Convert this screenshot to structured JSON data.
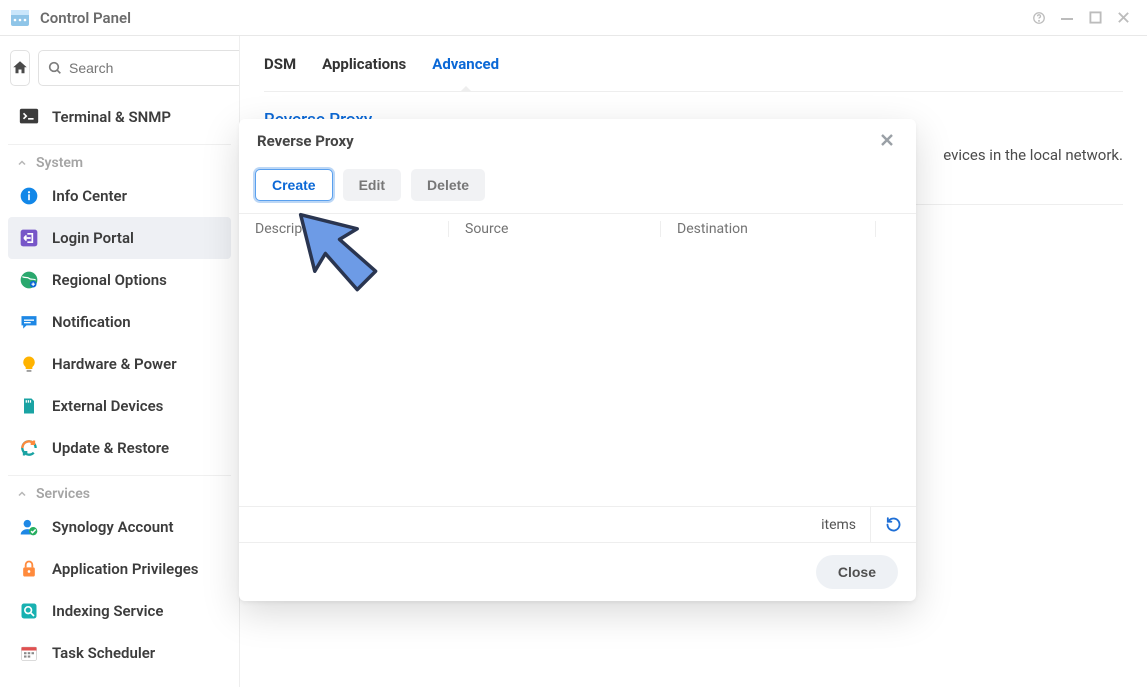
{
  "window": {
    "title": "Control Panel"
  },
  "sidebar": {
    "search_placeholder": "Search",
    "top_item": {
      "label": "Terminal & SNMP"
    },
    "sections": [
      {
        "label": "System",
        "items": [
          {
            "id": "info-center",
            "label": "Info Center"
          },
          {
            "id": "login-portal",
            "label": "Login Portal",
            "active": true
          },
          {
            "id": "regional-options",
            "label": "Regional Options"
          },
          {
            "id": "notification",
            "label": "Notification"
          },
          {
            "id": "hardware-power",
            "label": "Hardware & Power"
          },
          {
            "id": "external-devices",
            "label": "External Devices"
          },
          {
            "id": "update-restore",
            "label": "Update & Restore"
          }
        ]
      },
      {
        "label": "Services",
        "items": [
          {
            "id": "synology-account",
            "label": "Synology Account"
          },
          {
            "id": "application-privileges",
            "label": "Application Privileges"
          },
          {
            "id": "indexing-service",
            "label": "Indexing Service"
          },
          {
            "id": "task-scheduler",
            "label": "Task Scheduler"
          }
        ]
      }
    ]
  },
  "main": {
    "tabs": [
      {
        "label": "DSM"
      },
      {
        "label": "Applications"
      },
      {
        "label": "Advanced",
        "active": true
      }
    ],
    "section_title": "Reverse Proxy",
    "description_tail": "evices in the local network."
  },
  "dialog": {
    "title": "Reverse Proxy",
    "buttons": {
      "create": "Create",
      "edit": "Edit",
      "delete": "Delete",
      "close": "Close"
    },
    "columns": {
      "description": "Description",
      "source": "Source",
      "destination": "Destination"
    },
    "status": {
      "items_label": "items"
    }
  }
}
